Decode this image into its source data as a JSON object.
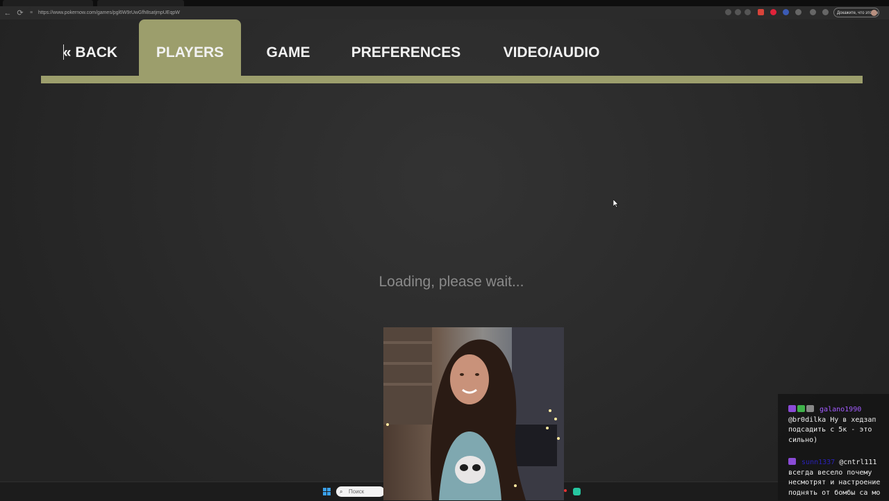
{
  "browser": {
    "url": "https://www.pokernow.com/games/pgl6W9rUwGfh8satjmpUEqpW",
    "profile_button": "Докажите, что это вы",
    "nav": {
      "back_glyph": "←",
      "reload_glyph": "⟳",
      "lock_glyph": "≡"
    }
  },
  "game_menu": {
    "back_label": "« BACK",
    "tabs": [
      {
        "label": "PLAYERS",
        "active": true
      },
      {
        "label": "GAME",
        "active": false
      },
      {
        "label": "PREFERENCES",
        "active": false
      },
      {
        "label": "VIDEO/AUDIO",
        "active": false
      }
    ],
    "accent_color": "#9c9e6c"
  },
  "main": {
    "loading_text": "Loading, please wait..."
  },
  "taskbar": {
    "search_placeholder": "Поиск"
  },
  "chat": {
    "messages": [
      {
        "username": "galano1990",
        "username_color": "#a35cff",
        "text_mention": "@br0dilka",
        "text": "Ну в хедзап подсадить с 5к - это сильно)"
      },
      {
        "username": "sunn1337",
        "username_color": "#2a21b8",
        "text_mention": "@cntrl111",
        "text": "всегда весело почему несмотрят и настроение поднять от бомбы са мо"
      }
    ]
  }
}
